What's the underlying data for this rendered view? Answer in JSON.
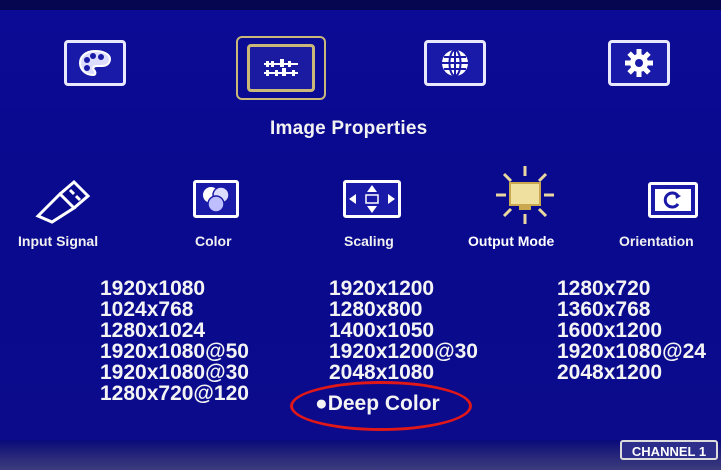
{
  "main_menu": {
    "tabs": [
      {
        "icon": "palette-icon"
      },
      {
        "icon": "image-properties-icon"
      },
      {
        "icon": "globe-icon"
      },
      {
        "icon": "gear-icon"
      }
    ],
    "selected_title": "Image Properties"
  },
  "sub_menu": {
    "items": [
      {
        "label": "Input Signal",
        "icon": "usb-connector-icon"
      },
      {
        "label": "Color",
        "icon": "color-circles-icon"
      },
      {
        "label": "Scaling",
        "icon": "scaling-arrows-icon"
      },
      {
        "label": "Output Mode",
        "icon": "monitor-sun-icon"
      },
      {
        "label": "Orientation",
        "icon": "rotate-screen-icon"
      }
    ],
    "active": "Output Mode"
  },
  "resolutions": {
    "col1": [
      "1920x1080",
      "1024x768",
      "1280x1024",
      "1920x1080@50",
      "1920x1080@30",
      "1280x720@120"
    ],
    "col2": [
      "1920x1200",
      "1280x800",
      "1400x1050",
      "1920x1200@30",
      "2048x1080"
    ],
    "col3": [
      "1280x720",
      "1360x768",
      "1600x1200",
      "1920x1080@24",
      "2048x1200"
    ]
  },
  "deep_color": {
    "label": "Deep Color",
    "bullet": "●"
  },
  "status": {
    "channel": "CHANNEL 1"
  },
  "colors": {
    "background": "#0a0a8e",
    "highlight_circle": "#e01818",
    "selected_frame": "#c9b878"
  }
}
